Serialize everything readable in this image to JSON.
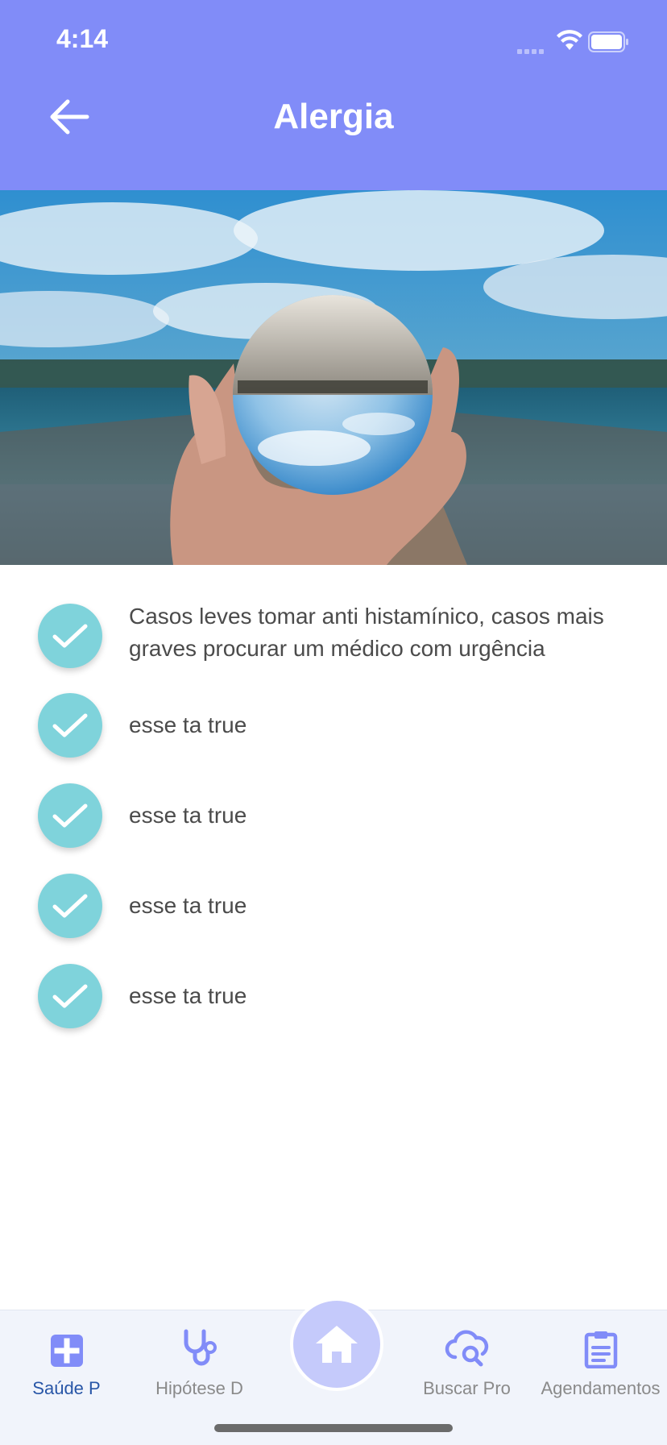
{
  "status_bar": {
    "time": "4:14"
  },
  "header": {
    "title": "Alergia"
  },
  "hero_image": {
    "description_icon": "crystal-ball-photo"
  },
  "items": [
    {
      "text": "Casos leves tomar anti histamínico, casos mais graves procurar um médico com urgência",
      "checked": true
    },
    {
      "text": "esse ta true",
      "checked": true
    },
    {
      "text": "esse ta true",
      "checked": true
    },
    {
      "text": "esse ta true",
      "checked": true
    },
    {
      "text": "esse ta true",
      "checked": true
    }
  ],
  "tabbar": {
    "tabs": [
      {
        "label": "Saúde P",
        "icon": "medical-plus-icon",
        "active": true
      },
      {
        "label": "Hipótese D",
        "icon": "stethoscope-icon",
        "active": false
      },
      {
        "label": "Buscar Pro",
        "icon": "cloud-search-icon",
        "active": false
      },
      {
        "label": "Agendamentos",
        "icon": "clipboard-icon",
        "active": false
      }
    ],
    "center_icon": "home-icon"
  },
  "colors": {
    "header": "#818CF8",
    "check": "#7FD3DB",
    "active_tab": "#2856a7",
    "home_button": "#C5CAFB"
  }
}
